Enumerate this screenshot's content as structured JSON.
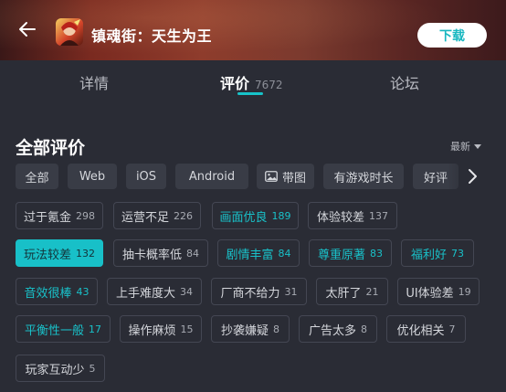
{
  "header": {
    "back_icon": "arrow-left-icon",
    "game_icon": "game-app-icon",
    "title": "镇魂街：天生为王",
    "download_label": "下载"
  },
  "tabs": [
    {
      "label": "详情",
      "count": ""
    },
    {
      "label": "评价",
      "count": "7672",
      "active": true
    },
    {
      "label": "论坛",
      "count": ""
    }
  ],
  "section": {
    "title": "全部评价",
    "sort_label": "最新"
  },
  "filters": [
    {
      "label": "全部"
    },
    {
      "label": "Web"
    },
    {
      "label": "iOS"
    },
    {
      "label": "Android"
    },
    {
      "label": "带图",
      "icon": "image-icon"
    },
    {
      "label": "有游戏时长"
    },
    {
      "label": "好评"
    }
  ],
  "tags": [
    {
      "label": "过于氪金",
      "count": "298"
    },
    {
      "label": "运营不足",
      "count": "226"
    },
    {
      "label": "画面优良",
      "count": "189"
    },
    {
      "label": "体验较差",
      "count": "137"
    },
    {
      "label": "玩法较差",
      "count": "132"
    },
    {
      "label": "抽卡概率低",
      "count": "84"
    },
    {
      "label": "剧情丰富",
      "count": "84"
    },
    {
      "label": "尊重原著",
      "count": "83"
    },
    {
      "label": "福利好",
      "count": "73"
    },
    {
      "label": "音效很棒",
      "count": "43"
    },
    {
      "label": "上手难度大",
      "count": "34"
    },
    {
      "label": "厂商不给力",
      "count": "31"
    },
    {
      "label": "太肝了",
      "count": "21"
    },
    {
      "label": "UI体验差",
      "count": "19"
    },
    {
      "label": "平衡性一般",
      "count": "17"
    },
    {
      "label": "操作麻烦",
      "count": "15"
    },
    {
      "label": "抄袭嫌疑",
      "count": "8"
    },
    {
      "label": "广告太多",
      "count": "8"
    },
    {
      "label": "优化相关",
      "count": "7"
    },
    {
      "label": "玩家互动少",
      "count": "5"
    }
  ],
  "colors": {
    "accent": "#18c0c8",
    "background": "#2a2c35",
    "chip": "#393c46"
  }
}
